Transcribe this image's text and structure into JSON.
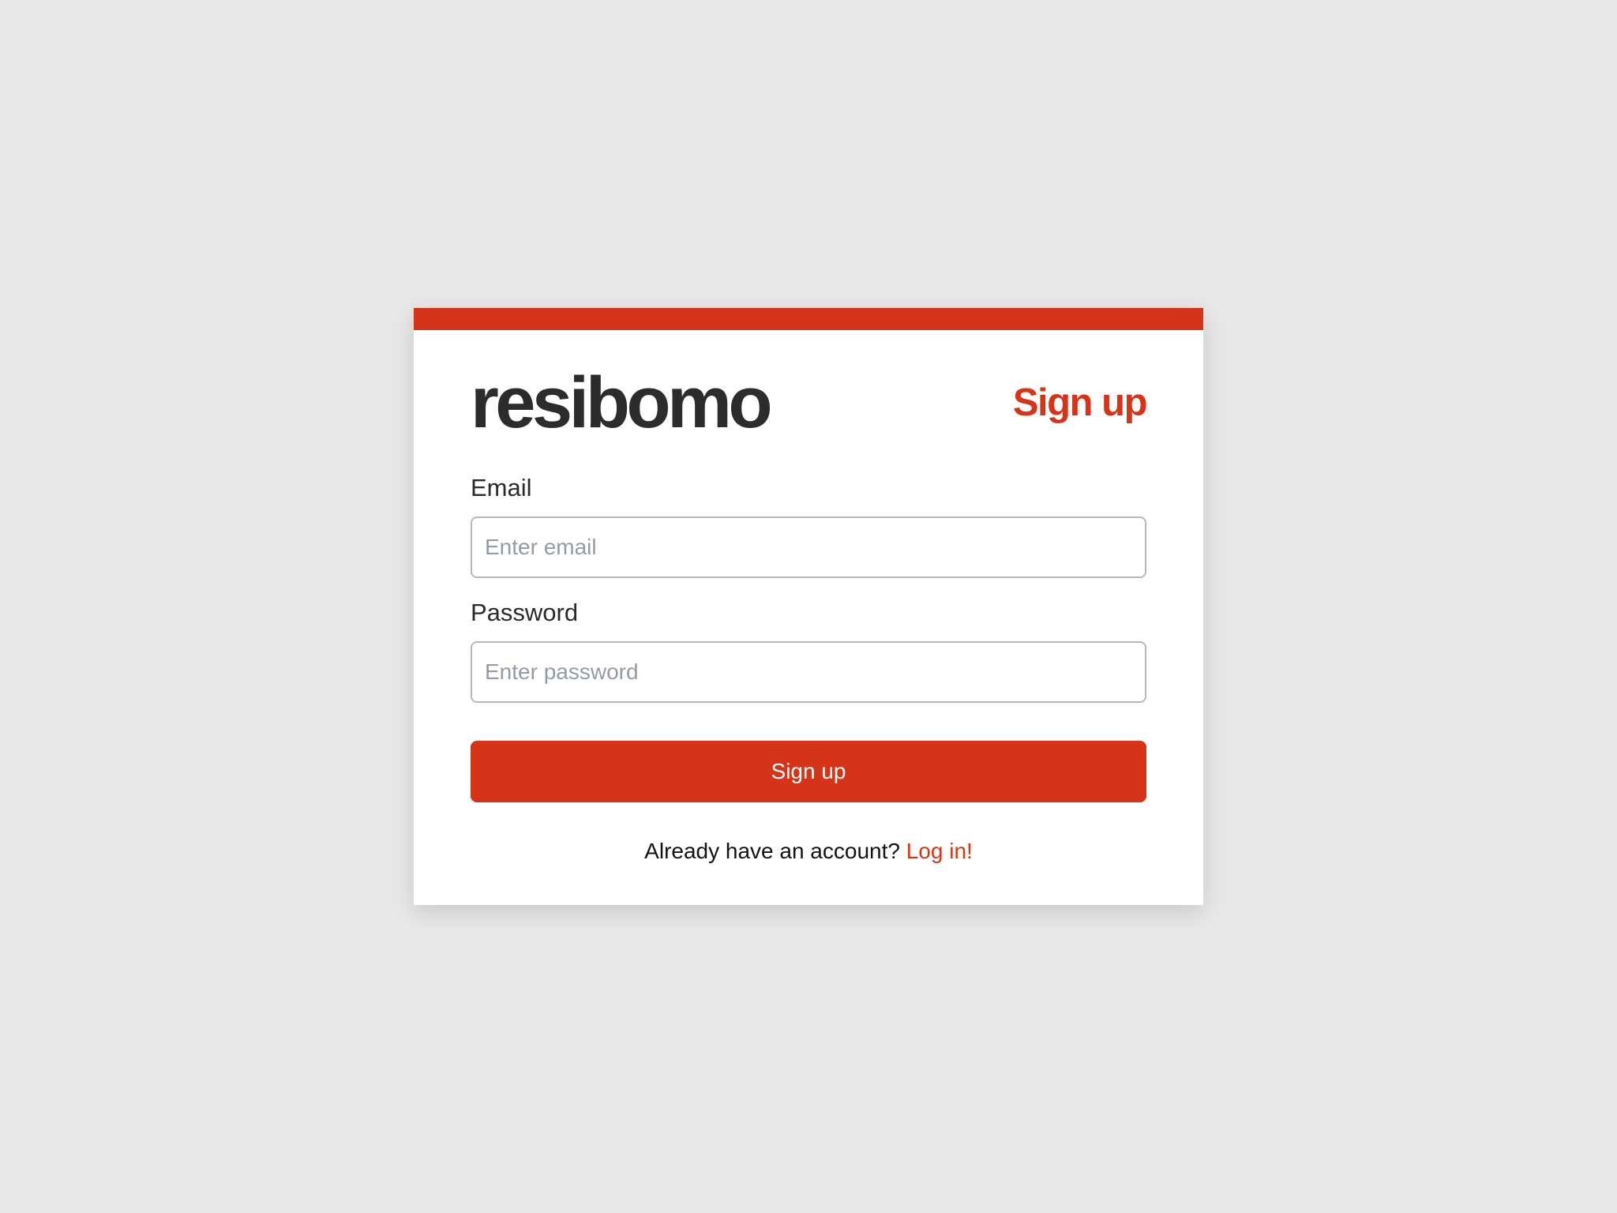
{
  "colors": {
    "background": "#e9e7e8",
    "accent": "#d53418",
    "logo_text": "#2c2c2c",
    "card": "#ffffff",
    "placeholder": "#949ba7"
  },
  "header": {
    "logo_text": "resibomo",
    "title": "Sign up"
  },
  "form": {
    "email": {
      "label": "Email",
      "placeholder": "Enter email",
      "value": ""
    },
    "password": {
      "label": "Password",
      "placeholder": "Enter password",
      "value": ""
    },
    "submit_label": "Sign up"
  },
  "footer": {
    "prompt": "Already have an account?",
    "link_label": "Log in!"
  }
}
